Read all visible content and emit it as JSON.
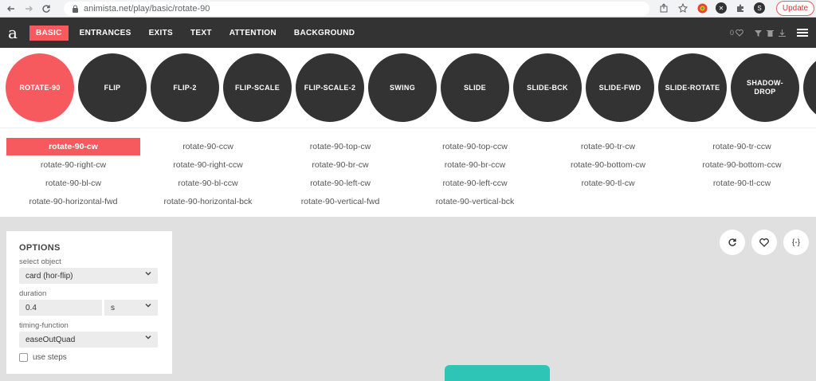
{
  "browser": {
    "url": "animista.net/play/basic/rotate-90",
    "update_label": "Update",
    "profile_initial": "S"
  },
  "header": {
    "logo": "a",
    "nav": [
      "BASIC",
      "ENTRANCES",
      "EXITS",
      "TEXT",
      "ATTENTION",
      "BACKGROUND"
    ],
    "active_nav": "BASIC",
    "counter": "0"
  },
  "animations": [
    {
      "label": "ROTATE-90",
      "active": true
    },
    {
      "label": "FLIP",
      "active": false
    },
    {
      "label": "FLIP-2",
      "active": false
    },
    {
      "label": "FLIP-SCALE",
      "active": false
    },
    {
      "label": "FLIP-SCALE-2",
      "active": false
    },
    {
      "label": "SWING",
      "active": false
    },
    {
      "label": "SLIDE",
      "active": false
    },
    {
      "label": "SLIDE-BCK",
      "active": false
    },
    {
      "label": "SLIDE-FWD",
      "active": false
    },
    {
      "label": "SLIDE-ROTATE",
      "active": false
    },
    {
      "label": "SHADOW-DROP",
      "active": false
    }
  ],
  "variants": [
    [
      "rotate-90-cw",
      "rotate-90-ccw",
      "rotate-90-top-cw",
      "rotate-90-top-ccw",
      "rotate-90-tr-cw",
      "rotate-90-tr-ccw"
    ],
    [
      "rotate-90-right-cw",
      "rotate-90-right-ccw",
      "rotate-90-br-cw",
      "rotate-90-br-ccw",
      "rotate-90-bottom-cw",
      "rotate-90-bottom-ccw"
    ],
    [
      "rotate-90-bl-cw",
      "rotate-90-bl-ccw",
      "rotate-90-left-cw",
      "rotate-90-left-ccw",
      "rotate-90-tl-cw",
      "rotate-90-tl-ccw"
    ],
    [
      "rotate-90-horizontal-fwd",
      "rotate-90-horizontal-bck",
      "rotate-90-vertical-fwd",
      "rotate-90-vertical-bck"
    ]
  ],
  "active_variant": "rotate-90-cw",
  "options": {
    "title": "OPTIONS",
    "select_object_label": "select object",
    "select_object_value": "card (hor-flip)",
    "duration_label": "duration",
    "duration_value": "0.4",
    "duration_unit": "s",
    "timing_label": "timing-function",
    "timing_value": "easeOutQuad",
    "use_steps_label": "use steps"
  },
  "actions": {
    "code_label": "{-}"
  },
  "colors": {
    "accent": "#f65a5f",
    "dark": "#333333",
    "teal": "#2ec4b6"
  }
}
